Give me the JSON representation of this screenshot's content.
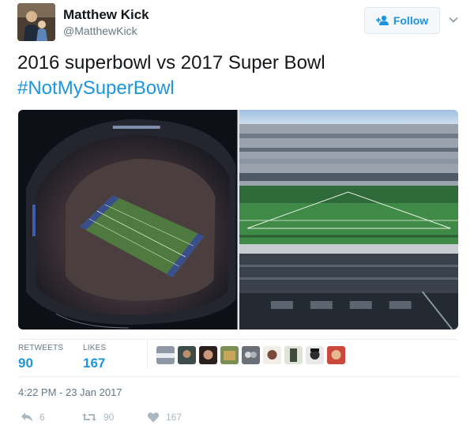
{
  "author": {
    "display_name": "Matthew Kick",
    "handle": "@MatthewKick"
  },
  "follow_button": {
    "label": "Follow",
    "icon": "add-user-icon"
  },
  "menu": {
    "icon": "chevron-down-icon"
  },
  "tweet": {
    "text": "2016 superbowl vs 2017 Super Bowl",
    "hashtag": "#NotMySuperBowl"
  },
  "media": [
    {
      "description_icon": "aerial-stadium-photo"
    },
    {
      "description_icon": "stadium-field-level-photo"
    }
  ],
  "stats": {
    "retweets_label": "RETWEETS",
    "retweets_value": "90",
    "likes_label": "LIKES",
    "likes_value": "167",
    "liker_count": 10
  },
  "timestamp": "4:22 PM - 23 Jan 2017",
  "actions": {
    "reply": {
      "icon": "reply-icon",
      "count": "6"
    },
    "retweet": {
      "icon": "retweet-icon",
      "count": "90"
    },
    "like": {
      "icon": "heart-icon",
      "count": "167"
    }
  },
  "colors": {
    "link": "#1b95e0",
    "muted": "#657786",
    "action": "#aab8c2",
    "border": "#e6ecf0"
  }
}
